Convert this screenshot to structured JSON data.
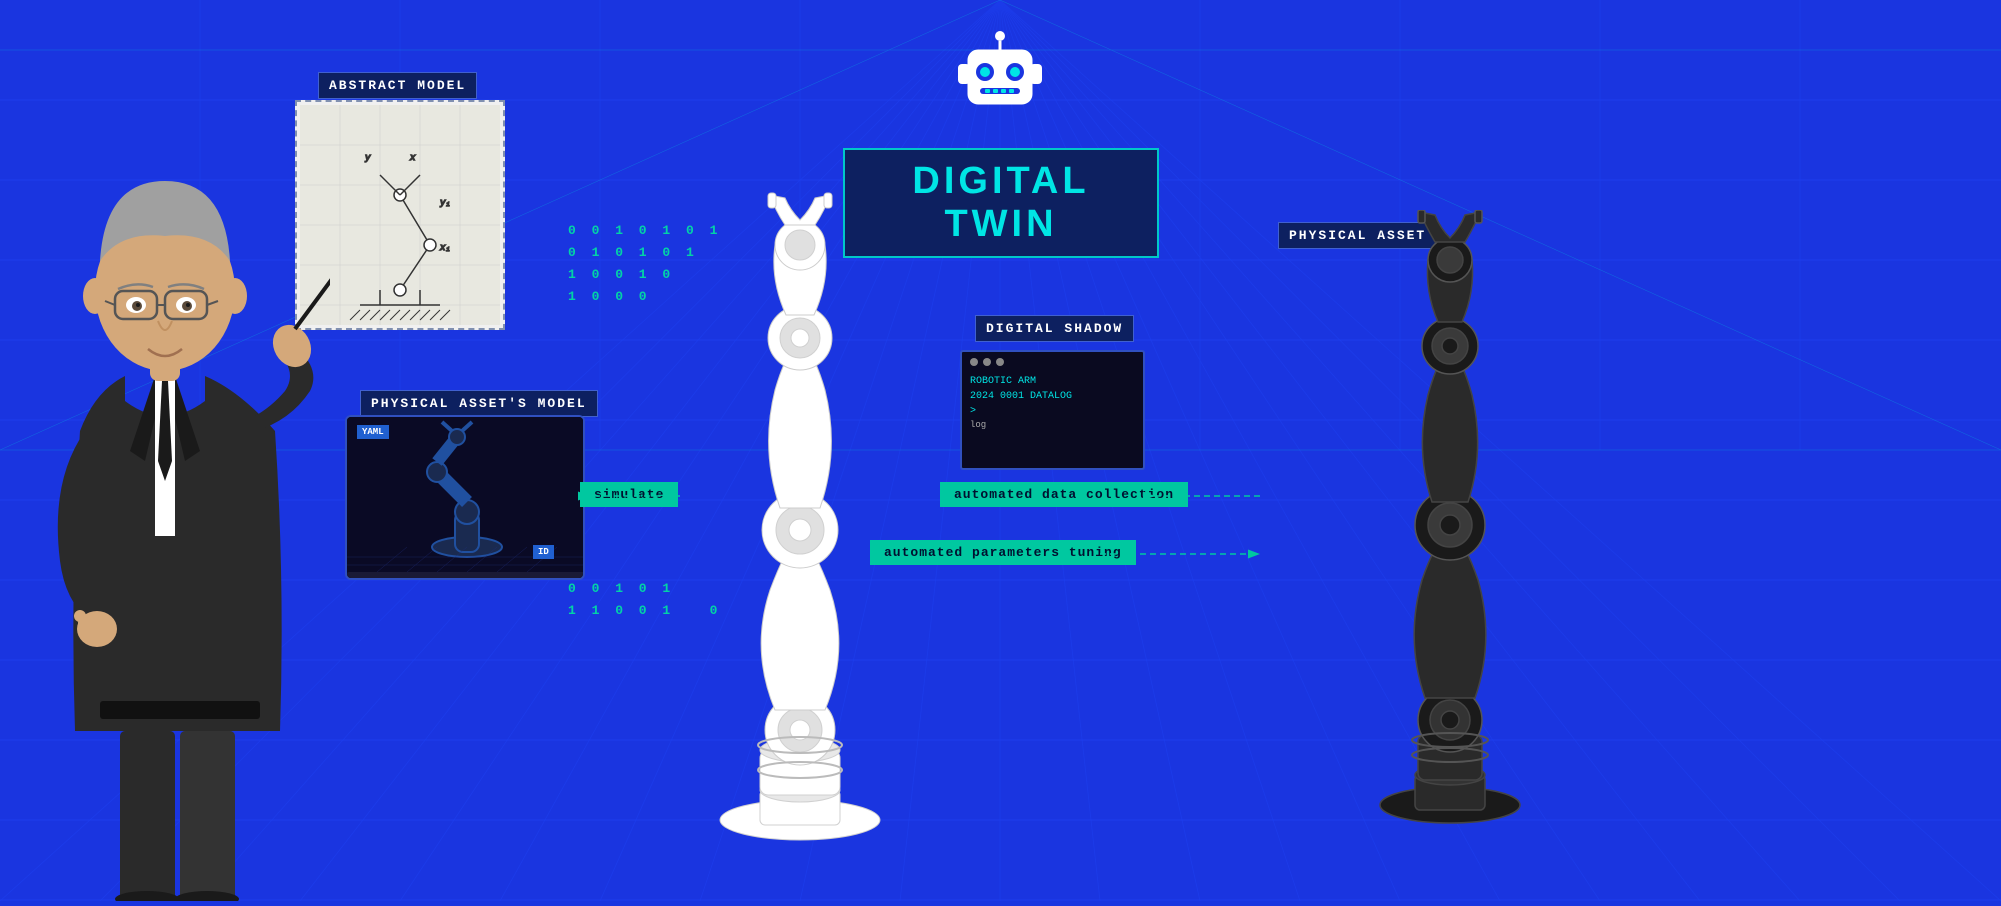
{
  "background_color": "#1a35e0",
  "grid_color": "#2244f0",
  "grid_accent": "#00c8ff",
  "title": {
    "text": "DIGITAL TWIN",
    "color": "#00e5e5",
    "bg": "#0d2060"
  },
  "labels": {
    "abstract_model": "ABSTRACT MODEL",
    "physical_model": "PHYSICAL ASSET'S MODEL",
    "physical_asset": "PHYSICAL ASSET",
    "digital_shadow": "DIGITAL SHADOW"
  },
  "badges": {
    "simulate": "simulate",
    "auto_data": "automated data collection",
    "auto_params": "automated parameters tuning"
  },
  "terminal": {
    "line1": "ROBOTIC ARM",
    "line2": "2024 0001 DATALOG",
    "line3": ">",
    "line4": "log",
    "cursor": "▌"
  },
  "binary_top": "0 0 1 0 1 0 1\n0 1 0 1 0 1\n1 0 0 1 0\n1 0 0 0",
  "binary_bottom": "0 0 1 0 1\n1 1 0 0 1   0",
  "yaml_label": "YAML",
  "id_label": "ID"
}
